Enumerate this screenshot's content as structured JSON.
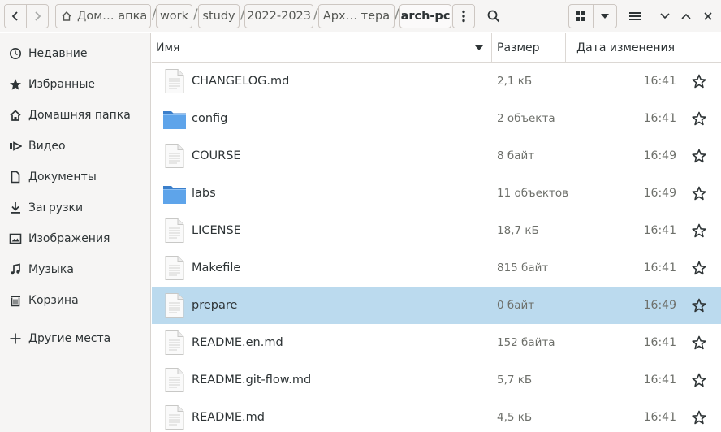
{
  "header": {
    "breadcrumbs": [
      "Дом… апка",
      "work",
      "study",
      "2022-2023",
      "Арх… тера",
      "arch-pc"
    ]
  },
  "sidebar": {
    "items": [
      {
        "label": "Недавние",
        "icon": "clock-icon"
      },
      {
        "label": "Избранные",
        "icon": "star-icon"
      },
      {
        "label": "Домашняя папка",
        "icon": "home-icon"
      },
      {
        "label": "Видео",
        "icon": "video-icon"
      },
      {
        "label": "Документы",
        "icon": "document-icon"
      },
      {
        "label": "Загрузки",
        "icon": "download-icon"
      },
      {
        "label": "Изображения",
        "icon": "image-icon"
      },
      {
        "label": "Музыка",
        "icon": "music-icon"
      },
      {
        "label": "Корзина",
        "icon": "trash-icon"
      }
    ],
    "other_places": "Другие места"
  },
  "columns": {
    "name": "Имя",
    "size": "Размер",
    "date": "Дата изменения"
  },
  "files": [
    {
      "name": "CHANGELOG.md",
      "size": "2,1 кБ",
      "date": "16:41",
      "type": "file"
    },
    {
      "name": "config",
      "size": "2 объекта",
      "date": "16:41",
      "type": "folder"
    },
    {
      "name": "COURSE",
      "size": "8 байт",
      "date": "16:49",
      "type": "file"
    },
    {
      "name": "labs",
      "size": "11 объектов",
      "date": "16:49",
      "type": "folder"
    },
    {
      "name": "LICENSE",
      "size": "18,7 кБ",
      "date": "16:41",
      "type": "file"
    },
    {
      "name": "Makefile",
      "size": "815 байт",
      "date": "16:41",
      "type": "file"
    },
    {
      "name": "prepare",
      "size": "0 байт",
      "date": "16:49",
      "type": "file",
      "selected": true
    },
    {
      "name": "README.en.md",
      "size": "152 байта",
      "date": "16:41",
      "type": "file"
    },
    {
      "name": "README.git-flow.md",
      "size": "5,7 кБ",
      "date": "16:41",
      "type": "file"
    },
    {
      "name": "README.md",
      "size": "4,5 кБ",
      "date": "16:41",
      "type": "file"
    }
  ],
  "colors": {
    "selection": "#bbdaee",
    "folder": "#4a90d9"
  }
}
